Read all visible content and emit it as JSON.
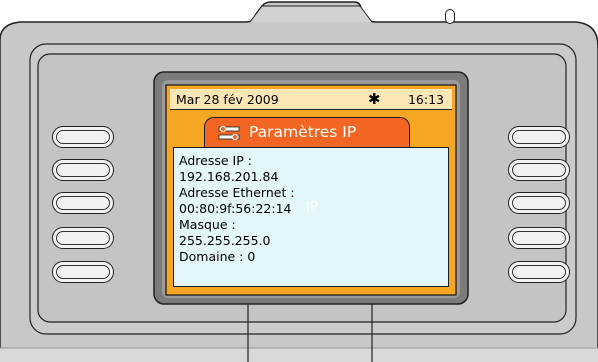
{
  "statusbar": {
    "date": "Mar 28 fév 2009",
    "weather_icon": "sun-icon",
    "time": "16:13"
  },
  "title": {
    "label": "Paramètres IP",
    "icon": "wrench-icon"
  },
  "info": {
    "ip_label": "Adresse IP :",
    "ip_value": "192.168.201.84",
    "mac_label": "Adresse Ethernet :",
    "mac_value": "00:80:9f:56:22:14",
    "mask_label": "Masque :",
    "mask_value": "255.255.255.0",
    "domain": "Domaine : 0",
    "ghost_text": "IP"
  },
  "colors": {
    "title_bg": "#f26522",
    "status_bg": "#fbe7b6",
    "content_bg": "#e3f6fb",
    "bezel": "#c8c8c8",
    "screen_frame": "#f5a623"
  }
}
